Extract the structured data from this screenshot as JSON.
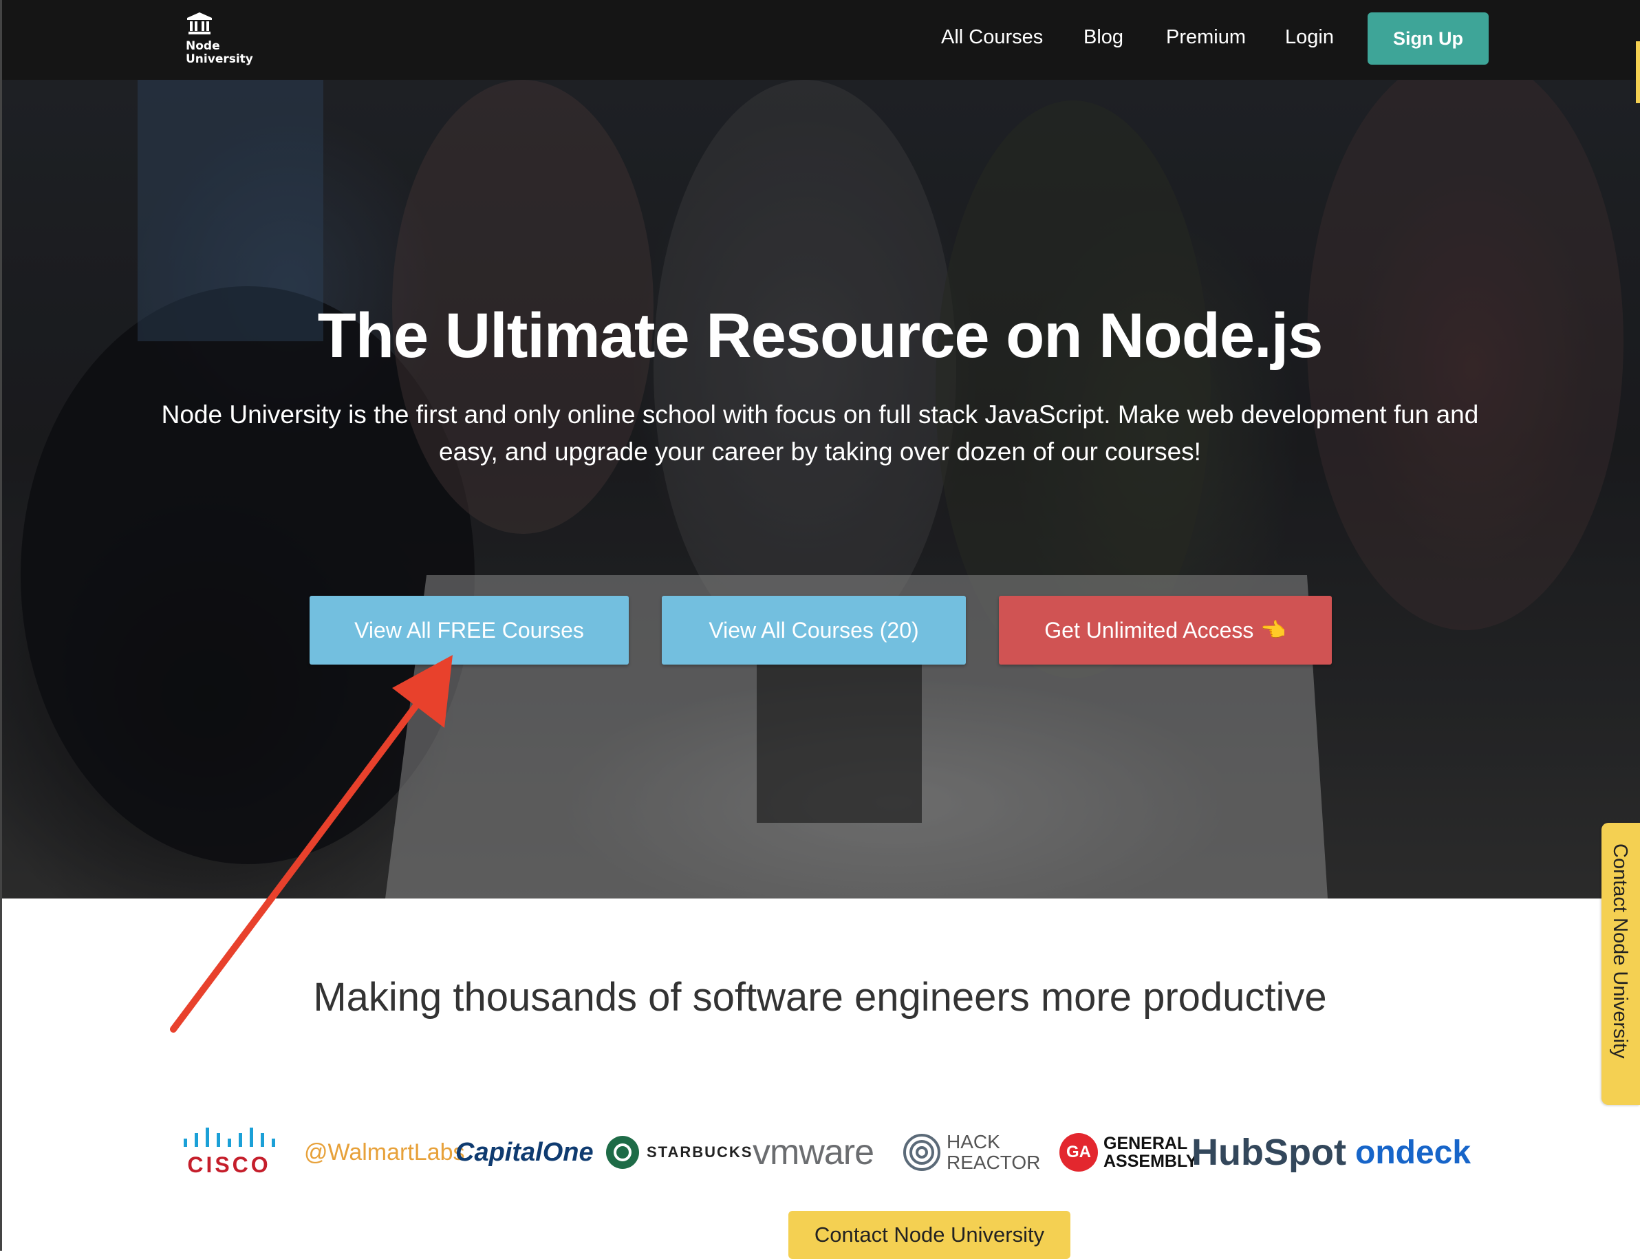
{
  "brand": {
    "logo_text": "Node\nUniversity"
  },
  "nav": {
    "links": [
      "All Courses",
      "Blog",
      "Premium",
      "Login"
    ],
    "signup": "Sign Up"
  },
  "hero": {
    "title": "The Ultimate Resource on Node.js",
    "subtitle": "Node University is the first and only online school with focus on full stack JavaScript. Make web development fun and easy, and upgrade your career by taking over dozen of our courses!",
    "buttons": {
      "free": "View All FREE Courses",
      "all": "View All Courses (20)",
      "unlimited": "Get Unlimited Access",
      "unlimited_icon": "👈"
    }
  },
  "side_tab": "Contact Node University",
  "section": {
    "heading": "Making thousands of software engineers more productive"
  },
  "logos": {
    "cisco": "CISCO",
    "walmart": "@WalmartLabs",
    "capitalone": "CapitalOne",
    "starbucks": "STARBUCKS",
    "vmware": "vmware",
    "hackreactor_1": "HACK",
    "hackreactor_2": "REACTOR",
    "ga_badge": "GA",
    "ga_1": "GENERAL",
    "ga_2": "ASSEMBLY",
    "hubspot": "HubSpot",
    "ondeck": "ondeck"
  },
  "contact_button": "Contact Node University",
  "colors": {
    "nav_bg": "#151515",
    "signup": "#3ea598",
    "cta_blue": "#73bfdf",
    "cta_red": "#d05353",
    "contact_yellow": "#f4d052",
    "annotation_arrow": "#e8412c"
  }
}
